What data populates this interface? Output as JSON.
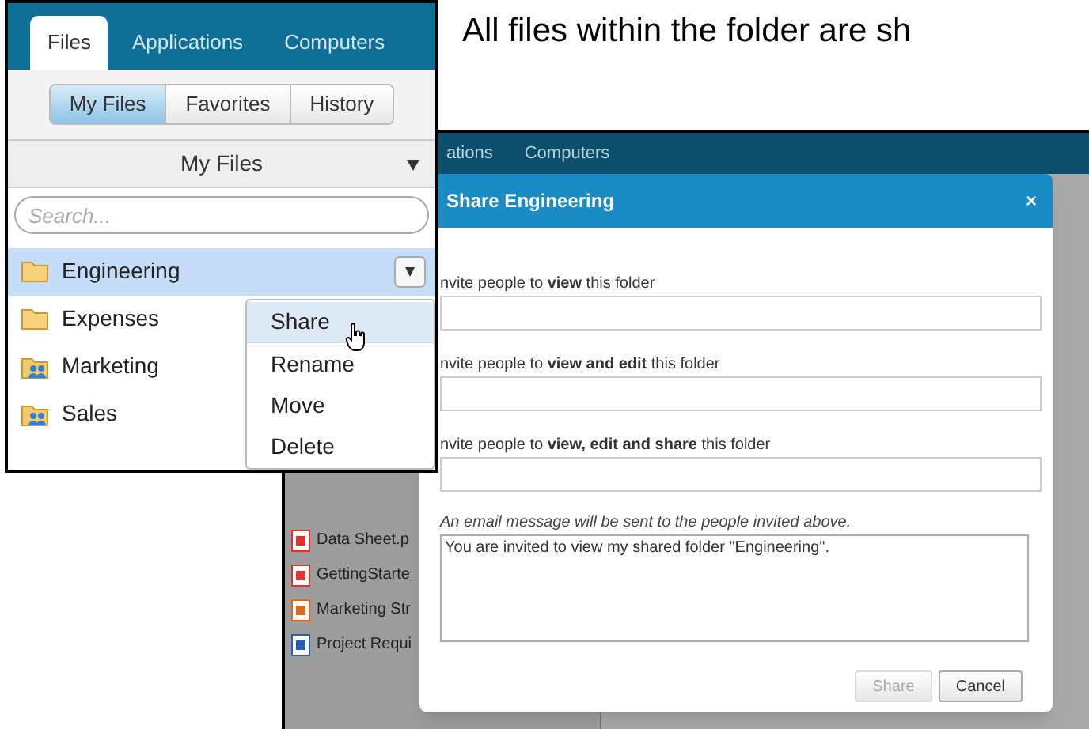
{
  "caption": "All files within the folder are sh",
  "panel": {
    "tabs": [
      {
        "label": "Files",
        "selected": true
      },
      {
        "label": "Applications",
        "selected": false
      },
      {
        "label": "Computers",
        "selected": false
      }
    ],
    "views": [
      {
        "label": "My Files",
        "selected": true
      },
      {
        "label": "Favorites",
        "selected": false
      },
      {
        "label": "History",
        "selected": false
      }
    ],
    "header": "My Files",
    "search": {
      "placeholder": "Search..."
    },
    "folders": [
      {
        "name": "Engineering",
        "kind": "folder",
        "selected": true
      },
      {
        "name": "Expenses",
        "kind": "folder",
        "selected": false
      },
      {
        "name": "Marketing",
        "kind": "shared",
        "selected": false
      },
      {
        "name": "Sales",
        "kind": "shared",
        "selected": false
      }
    ],
    "context_menu": [
      {
        "label": "Share",
        "selected": true
      },
      {
        "label": "Rename",
        "selected": false
      },
      {
        "label": "Move",
        "selected": false
      },
      {
        "label": "Delete",
        "selected": false
      }
    ]
  },
  "background_window": {
    "tabs": [
      "ations",
      "Computers"
    ],
    "files": [
      {
        "name": "Data Sheet.p",
        "kind": "pdf"
      },
      {
        "name": "GettingStarte",
        "kind": "pdf"
      },
      {
        "name": "Marketing Str",
        "kind": "ppt"
      },
      {
        "name": "Project Requi",
        "kind": "doc"
      }
    ]
  },
  "dialog": {
    "title": "Share Engineering",
    "close": "×",
    "fields": [
      {
        "label": "nvite people to **view** this folder"
      },
      {
        "label": "nvite people to **view and edit** this folder"
      },
      {
        "label": "nvite people to **view, edit and share** this folder"
      }
    ],
    "note": "An email message will be sent to the people invited above.",
    "message": "You are invited to view my shared folder \"Engineering\".",
    "buttons": [
      {
        "label": "Share",
        "disabled": true
      },
      {
        "label": "Cancel",
        "disabled": false
      }
    ]
  }
}
